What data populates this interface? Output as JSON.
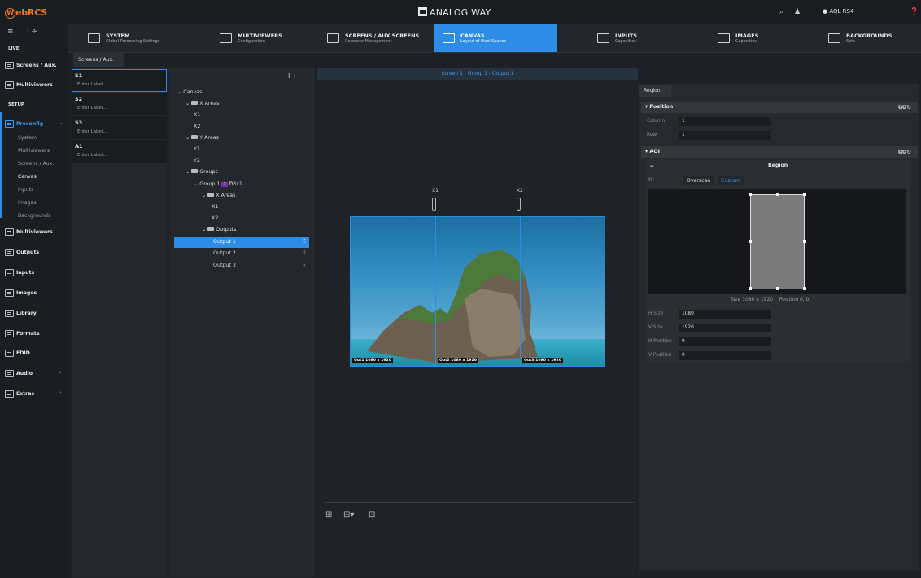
{
  "app": {
    "logo": "ebRCS",
    "logo_initial": "W",
    "brand": "ANALOG WAY",
    "user": "AQL RS4"
  },
  "topicons": {
    "search": "search-icon",
    "bell": "bell-icon",
    "info": "info-icon",
    "help": "help-icon"
  },
  "sidenav": {
    "live": "LIVE",
    "setup": "SETUP",
    "screens_aux": "Screens / Aux.",
    "multiviewers": "Multiviewers",
    "preconfig": "Preconfig",
    "preconfig_items": [
      "System",
      "Multiviewers",
      "Screens / Aux.",
      "Canvas",
      "Inputs",
      "Images",
      "Backgrounds"
    ],
    "bottom_items": [
      "Multiviewers",
      "Outputs",
      "Inputs",
      "Images",
      "Library",
      "Formats",
      "EDID",
      "Audio",
      "Extras"
    ]
  },
  "tabs": [
    {
      "title": "SYSTEM",
      "sub": "Global Processing Settings"
    },
    {
      "title": "MULTIVIEWERS",
      "sub": "Configuration"
    },
    {
      "title": "SCREENS / AUX SCREENS",
      "sub": "Resource Management"
    },
    {
      "title": "CANVAS",
      "sub": "Layout of Pixel Spaces"
    },
    {
      "title": "INPUTS",
      "sub": "Capacities"
    },
    {
      "title": "IMAGES",
      "sub": "Capacities"
    },
    {
      "title": "BACKGROUNDS",
      "sub": "Sets"
    }
  ],
  "subtab": "Screens / Aux.",
  "screens": [
    {
      "name": "S1",
      "label": "Enter Label..."
    },
    {
      "name": "S2",
      "label": "Enter Label..."
    },
    {
      "name": "S3",
      "label": "Enter Label..."
    },
    {
      "name": "A1",
      "label": "Enter Label..."
    }
  ],
  "tree": {
    "canvas": "Canvas",
    "xareas": "X Areas",
    "x1": "X1",
    "x2": "X2",
    "yareas": "Y Areas",
    "y1": "Y1",
    "y2": "Y2",
    "groups": "Groups",
    "group1": "Group 1",
    "group1_badge": "2",
    "group1_size": "3x1",
    "gx_areas": "X Areas",
    "gx1": "X1",
    "gx2": "X2",
    "outputs": "Outputs",
    "output_items": [
      "Output 1",
      "Output 2",
      "Output 3"
    ]
  },
  "canvas": {
    "header": "Screen 1 - Group 1 - Output 1",
    "x_labels": [
      "X1",
      "X2"
    ],
    "out_labels": [
      "Out1 1080 x 1920",
      "Out2 1080 x 1920",
      "Out3 1080 x 1920"
    ]
  },
  "right": {
    "region_tab": "Region",
    "position": {
      "title": "Position",
      "column_label": "Column",
      "column": "1",
      "row_label": "Row",
      "row": "1"
    },
    "aoi": {
      "title": "AOI",
      "region_title": "Region",
      "fit_label": "Fit",
      "fit_options": [
        "Overscan",
        "Custom"
      ],
      "fit_selected": "Custom",
      "size_text": "Size 1080 x 1920",
      "pos_text": "Position 0, 0",
      "hsize_label": "H Size",
      "hsize": "1080",
      "vsize_label": "V Size",
      "vsize": "1920",
      "hpos_label": "H Position",
      "hpos": "0",
      "vpos_label": "V Position",
      "vpos": "0"
    }
  },
  "colors": {
    "accent": "#2d8ce6",
    "logo": "#e07828"
  }
}
